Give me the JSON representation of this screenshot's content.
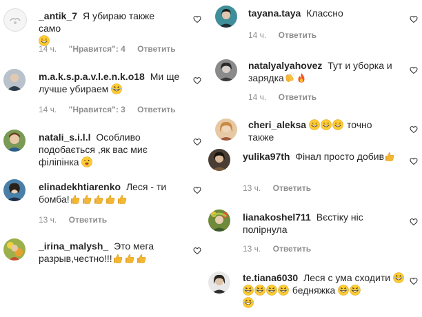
{
  "left": [
    {
      "user": "_antik_7",
      "text": "Я убираю также само",
      "emoji": [
        "grin"
      ],
      "time": "14 ч.",
      "likes": "\"Нравится\": 4",
      "reply": "Ответить",
      "avatar_color": "#e8e8e8"
    },
    {
      "user": "m.a.k.s.p.a.v.l.e.n.k.o18",
      "text": "Ми ще лучше убираем",
      "emoji": [
        "laugh"
      ],
      "time": "14 ч.",
      "likes": "\"Нравится\": 3",
      "reply": "Ответить",
      "avatar_color": "#9aa7b3"
    },
    {
      "user": "natali_s.i.l.l",
      "text": "Особливо подобається ,як вас миє філіпінка",
      "emoji": [
        "tongue"
      ],
      "time": "",
      "likes": "",
      "reply": "",
      "avatar_color": "#6b8a4d"
    },
    {
      "user": "elinadekhtiarenko",
      "text": "Леся - ти бомба!",
      "emoji": [
        "thumb",
        "thumb",
        "thumb",
        "thumb",
        "thumb"
      ],
      "time": "13 ч.",
      "likes": "",
      "reply": "Ответить",
      "avatar_color": "#4a7fa8"
    },
    {
      "user": "_irina_malysh_",
      "text": "Это мега разрыв,честно!!!",
      "emoji": [
        "thumb",
        "thumb",
        "thumb"
      ],
      "time": "",
      "likes": "",
      "reply": "",
      "avatar_color": "#c9a23c"
    }
  ],
  "right": [
    {
      "user": "tayana.taya",
      "text": "Классно",
      "emoji": [],
      "time": "14 ч.",
      "likes": "",
      "reply": "Ответить",
      "avatar_color": "#2f7a86"
    },
    {
      "user": "natalyalyahovez",
      "text": "Тут и уборка и зарядка",
      "emoji": [
        "clap",
        "fire"
      ],
      "time": "14 ч.",
      "likes": "",
      "reply": "Ответить",
      "avatar_color": "#7a7a7a"
    },
    {
      "user": "cheri_aleksa",
      "text": "точно также",
      "emoji": [
        "grin",
        "grin",
        "grin"
      ],
      "time": "",
      "likes": "",
      "reply": "",
      "avatar_color": "#d49a5a"
    },
    {
      "user": "yulika97th",
      "text": "Фінал просто добив",
      "emoji": [
        "thumb"
      ],
      "time": "13 ч.",
      "likes": "",
      "reply": "Ответить",
      "avatar_color": "#5a4a3c"
    },
    {
      "user": "lianakoshel711",
      "text": "Вєстіку ніс полірнула",
      "emoji": [],
      "time": "13 ч.",
      "likes": "",
      "reply": "Ответить",
      "avatar_color": "#6f8a3a"
    },
    {
      "user": "te.tiana6030",
      "text": "Леся с ума сходити",
      "emoji2": "бедняжка",
      "emoji": [
        "laugh",
        "laugh",
        "laugh",
        "laugh",
        "laugh"
      ],
      "emoji_after": [
        "laugh",
        "laugh"
      ],
      "time": "",
      "likes": "",
      "reply": "",
      "avatar_color": "#8a8a8a"
    }
  ],
  "colors": {
    "meta": "#8e8e8e",
    "text": "#262626",
    "heart": "#8e8e8e",
    "emoji_face": "#ffcc33",
    "thumb": "#f5b731"
  }
}
